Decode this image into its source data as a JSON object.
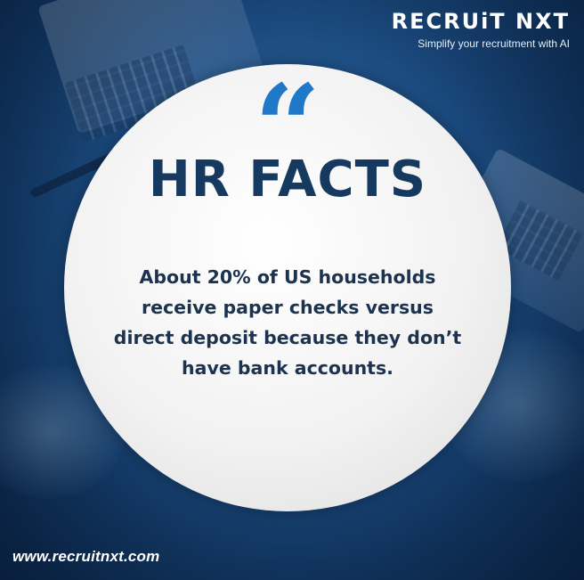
{
  "brand": {
    "logo_text": "RECRUiT NXT",
    "tagline": "Simplify your recruitment with AI"
  },
  "card": {
    "quote_mark": "“",
    "headline": "HR FACTS",
    "fact_text": "About 20% of US households receive paper checks versus direct deposit because they don’t have bank accounts."
  },
  "footer": {
    "website": "www.recruitnxt.com"
  },
  "colors": {
    "background": "#1d4f86",
    "headline": "#163a5f",
    "quote_mark": "#1f78c8",
    "fact_text": "#1c3350",
    "circle": "#f2f2f2"
  }
}
